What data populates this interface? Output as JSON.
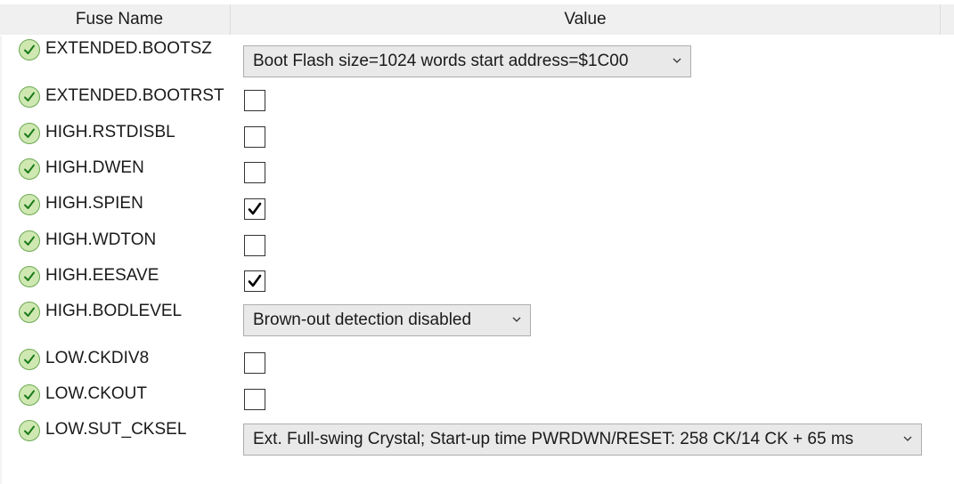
{
  "header": {
    "fuse_name": "Fuse Name",
    "value": "Value"
  },
  "rows": [
    {
      "name": "EXTENDED.BOOTSZ",
      "control": "dropdown",
      "value": "Boot Flash size=1024 words start address=$1C00",
      "status_icon": "check-circle-icon"
    },
    {
      "name": "EXTENDED.BOOTRST",
      "control": "checkbox",
      "checked": false,
      "status_icon": "check-circle-icon"
    },
    {
      "name": "HIGH.RSTDISBL",
      "control": "checkbox",
      "checked": false,
      "status_icon": "check-circle-icon"
    },
    {
      "name": "HIGH.DWEN",
      "control": "checkbox",
      "checked": false,
      "status_icon": "check-circle-icon"
    },
    {
      "name": "HIGH.SPIEN",
      "control": "checkbox",
      "checked": true,
      "status_icon": "check-circle-icon"
    },
    {
      "name": "HIGH.WDTON",
      "control": "checkbox",
      "checked": false,
      "status_icon": "check-circle-icon"
    },
    {
      "name": "HIGH.EESAVE",
      "control": "checkbox",
      "checked": true,
      "status_icon": "check-circle-icon"
    },
    {
      "name": "HIGH.BODLEVEL",
      "control": "dropdown",
      "value": "Brown-out detection disabled",
      "status_icon": "check-circle-icon"
    },
    {
      "name": "LOW.CKDIV8",
      "control": "checkbox",
      "checked": false,
      "status_icon": "check-circle-icon"
    },
    {
      "name": "LOW.CKOUT",
      "control": "checkbox",
      "checked": false,
      "status_icon": "check-circle-icon"
    },
    {
      "name": "LOW.SUT_CKSEL",
      "control": "dropdown",
      "value": "Ext. Full-swing Crystal; Start-up time PWRDWN/RESET: 258 CK/14 CK + 65 ms",
      "status_icon": "check-circle-icon"
    }
  ],
  "colors": {
    "status_fill": "#cfe8b2",
    "status_border": "#6aa84f",
    "dropdown_bg": "#e9e9e9",
    "header_bg": "#f0f0f0"
  }
}
